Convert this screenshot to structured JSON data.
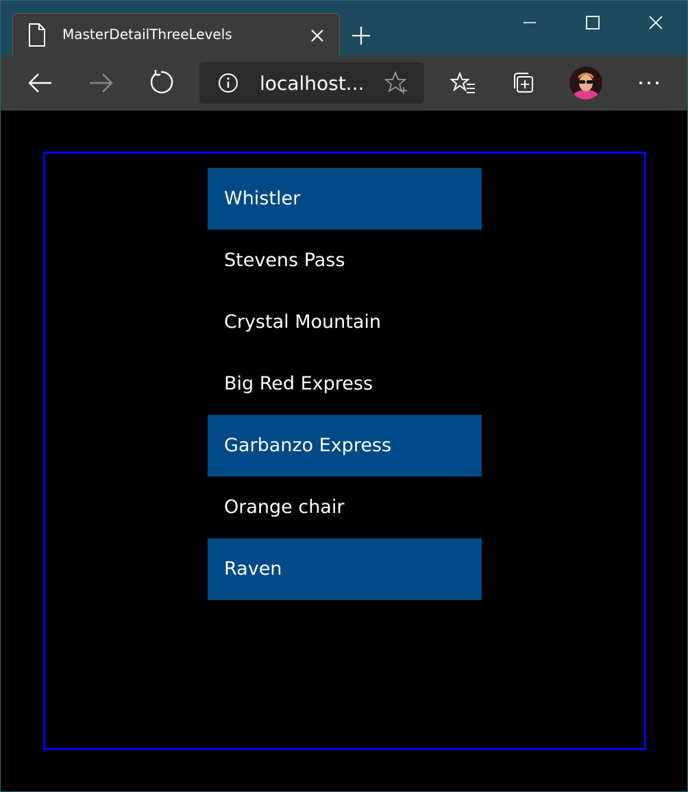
{
  "browser": {
    "tab": {
      "title": "MasterDetailThreeLevels"
    },
    "address_bar": {
      "url": "localhost..."
    },
    "colors": {
      "titlebar": "#1e4a5e",
      "toolbar": "#3b3b3b",
      "frame_border": "#0000ff",
      "selected_item": "#004a87"
    },
    "icons": {
      "tab": "page-icon",
      "close_tab": "close-icon",
      "new_tab": "plus-icon",
      "minimize": "minimize-icon",
      "maximize": "maximize-icon",
      "close_window": "close-icon",
      "back": "back-arrow-icon",
      "forward": "forward-arrow-icon",
      "refresh": "refresh-icon",
      "info": "info-icon",
      "add_favorite": "star-plus-icon",
      "favorites": "favorites-icon",
      "collections": "collections-icon",
      "profile": "avatar",
      "more": "ellipsis-icon"
    }
  },
  "list": {
    "items": [
      {
        "label": "Whistler",
        "selected": true
      },
      {
        "label": "Stevens Pass",
        "selected": false
      },
      {
        "label": "Crystal Mountain",
        "selected": false
      },
      {
        "label": "Big Red Express",
        "selected": false
      },
      {
        "label": "Garbanzo Express",
        "selected": true
      },
      {
        "label": "Orange chair",
        "selected": false
      },
      {
        "label": "Raven",
        "selected": true
      }
    ]
  }
}
